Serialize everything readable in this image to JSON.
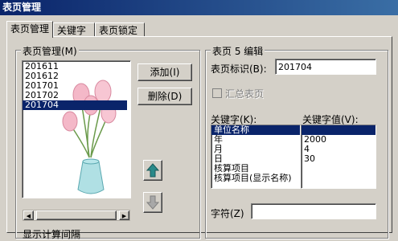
{
  "window": {
    "title": "表页管理"
  },
  "tabs": [
    {
      "label": "表页管理"
    },
    {
      "label": "关键字"
    },
    {
      "label": "表页锁定"
    }
  ],
  "list_group": {
    "title": "表页管理(M)",
    "items": [
      "201611",
      "201612",
      "201701",
      "201702",
      "201704"
    ],
    "selected_index": 4,
    "add_button": "添加(I)",
    "delete_button": "删除(D)"
  },
  "edit_group": {
    "title": "表页 5 编辑",
    "id_label": "表页标识(B):",
    "id_value": "201704",
    "summary_label": "汇总表页",
    "keyword_label": "关键字(K):",
    "keyword_value_label": "关键字值(V):",
    "keywords": [
      "单位名称",
      "年",
      "月",
      "日",
      "核算项目",
      "核算项目(显示名称)"
    ],
    "keyword_values": [
      "",
      "2000",
      "4",
      "30",
      "",
      ""
    ],
    "char_label": "字符(Z)",
    "char_value": ""
  },
  "bottom_label": "显示计算间隔"
}
